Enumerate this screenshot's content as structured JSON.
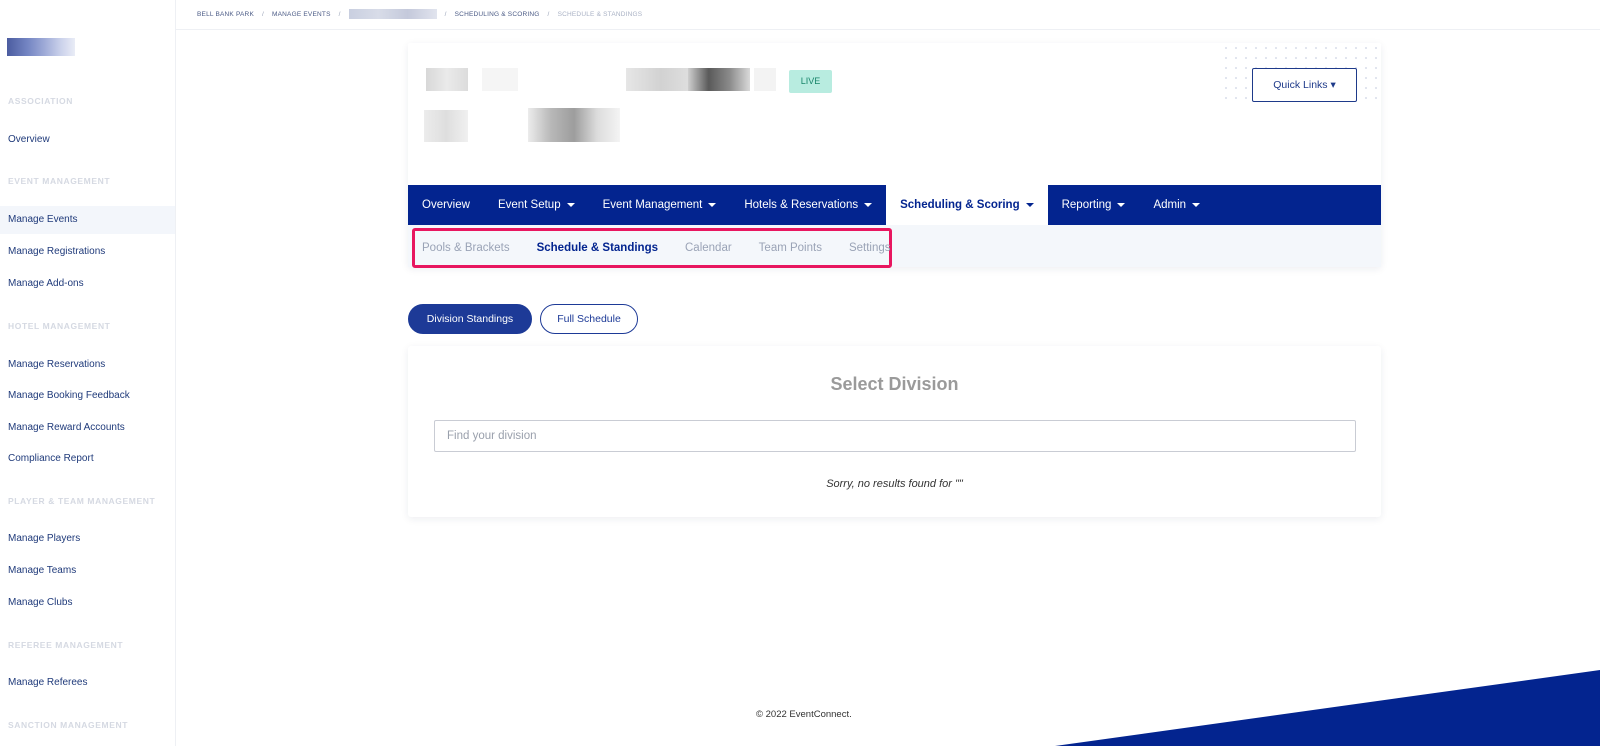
{
  "sidebar": {
    "sections": [
      {
        "title": "ASSOCIATION",
        "items": [
          "Overview"
        ]
      },
      {
        "title": "EVENT MANAGEMENT",
        "items": [
          "Manage Events",
          "Manage Registrations",
          "Manage Add-ons"
        ]
      },
      {
        "title": "HOTEL MANAGEMENT",
        "items": [
          "Manage Reservations",
          "Manage Booking Feedback",
          "Manage Reward Accounts",
          "Compliance Report"
        ]
      },
      {
        "title": "PLAYER & TEAM MANAGEMENT",
        "items": [
          "Manage Players",
          "Manage Teams",
          "Manage Clubs"
        ]
      },
      {
        "title": "REFEREE MANAGEMENT",
        "items": [
          "Manage Referees"
        ]
      },
      {
        "title": "SANCTION MANAGEMENT",
        "items": []
      }
    ],
    "active_item": "Manage Events"
  },
  "breadcrumb": {
    "items": [
      "BELL BANK PARK",
      "MANAGE EVENTS",
      "SCHEDULING & SCORING",
      "SCHEDULE & STANDINGS"
    ],
    "separator": "/"
  },
  "event": {
    "status_badge": "LIVE",
    "quick_links_label": "Quick Links ▾"
  },
  "main_nav": {
    "items": [
      {
        "label": "Overview",
        "dropdown": false
      },
      {
        "label": "Event Setup",
        "dropdown": true
      },
      {
        "label": "Event Management",
        "dropdown": true
      },
      {
        "label": "Hotels & Reservations",
        "dropdown": true
      },
      {
        "label": "Scheduling & Scoring",
        "dropdown": true,
        "active": true
      },
      {
        "label": "Reporting",
        "dropdown": true
      },
      {
        "label": "Admin",
        "dropdown": true
      }
    ]
  },
  "sub_nav": {
    "items": [
      {
        "label": "Pools & Brackets"
      },
      {
        "label": "Schedule & Standings",
        "active": true
      },
      {
        "label": "Calendar"
      },
      {
        "label": "Team Points"
      },
      {
        "label": "Settings"
      }
    ],
    "highlight_color": "#e8165f"
  },
  "view_toggle": {
    "primary": "Division Standings",
    "secondary": "Full Schedule"
  },
  "division": {
    "title": "Select Division",
    "search_placeholder": "Find your division",
    "search_value": "",
    "no_results": "Sorry, no results found for \"\""
  },
  "footer": {
    "copyright": "© 2022 EventConnect."
  },
  "colors": {
    "brand": "#03248f",
    "live_bg": "#b8ece0",
    "live_text": "#17856a"
  }
}
